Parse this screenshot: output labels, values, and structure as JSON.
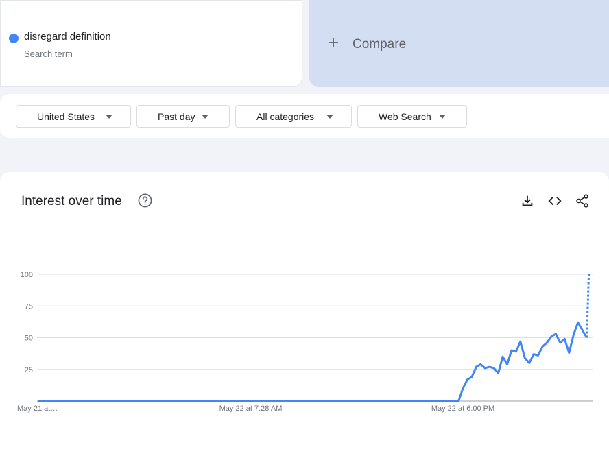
{
  "search": {
    "term": "disregard definition",
    "term_type": "Search term",
    "term_color": "#4285f4",
    "compare_label": "Compare",
    "compare_icon": "plus-icon"
  },
  "filters": [
    {
      "label": "United States",
      "icon": "caret-down-icon"
    },
    {
      "label": "Past day",
      "icon": "caret-down-icon"
    },
    {
      "label": "All categories",
      "icon": "caret-down-icon"
    },
    {
      "label": "Web Search",
      "icon": "caret-down-icon"
    }
  ],
  "interest_card": {
    "title": "Interest over time",
    "help_icon": "help-icon",
    "actions": [
      "download-icon",
      "embed-code-icon",
      "share-icon"
    ]
  },
  "chart_data": {
    "type": "line",
    "title": "Interest over time",
    "xlabel": "",
    "ylabel": "",
    "ylim": [
      0,
      100
    ],
    "yticks": [
      25,
      50,
      75,
      100
    ],
    "grid": true,
    "x_tick_labels": [
      "May 21 at…",
      "May 22 at 7:28 AM",
      "May 22 at 6:00 PM"
    ],
    "x_tick_index": [
      0,
      48,
      96
    ],
    "series": [
      {
        "color": "#4285f4",
        "values": [
          0,
          0,
          0,
          0,
          0,
          0,
          0,
          0,
          0,
          0,
          0,
          0,
          0,
          0,
          0,
          0,
          0,
          0,
          0,
          0,
          0,
          0,
          0,
          0,
          0,
          0,
          0,
          0,
          0,
          0,
          0,
          0,
          0,
          0,
          0,
          0,
          0,
          0,
          0,
          0,
          0,
          0,
          0,
          0,
          0,
          0,
          0,
          0,
          0,
          0,
          0,
          0,
          0,
          0,
          0,
          0,
          0,
          0,
          0,
          0,
          0,
          0,
          0,
          0,
          0,
          0,
          0,
          0,
          0,
          0,
          0,
          0,
          0,
          0,
          0,
          0,
          0,
          0,
          0,
          0,
          0,
          0,
          0,
          0,
          0,
          0,
          0,
          0,
          0,
          0,
          0,
          0,
          0,
          0,
          0,
          0,
          10,
          17,
          19,
          27,
          29,
          26,
          27,
          26,
          22,
          35,
          29,
          40,
          39,
          47,
          34,
          30,
          37,
          36,
          43,
          46,
          51,
          53,
          46,
          49,
          38,
          52,
          62,
          56,
          50
        ],
        "partial_from_index": 124,
        "partial_end_value": 100
      }
    ]
  }
}
